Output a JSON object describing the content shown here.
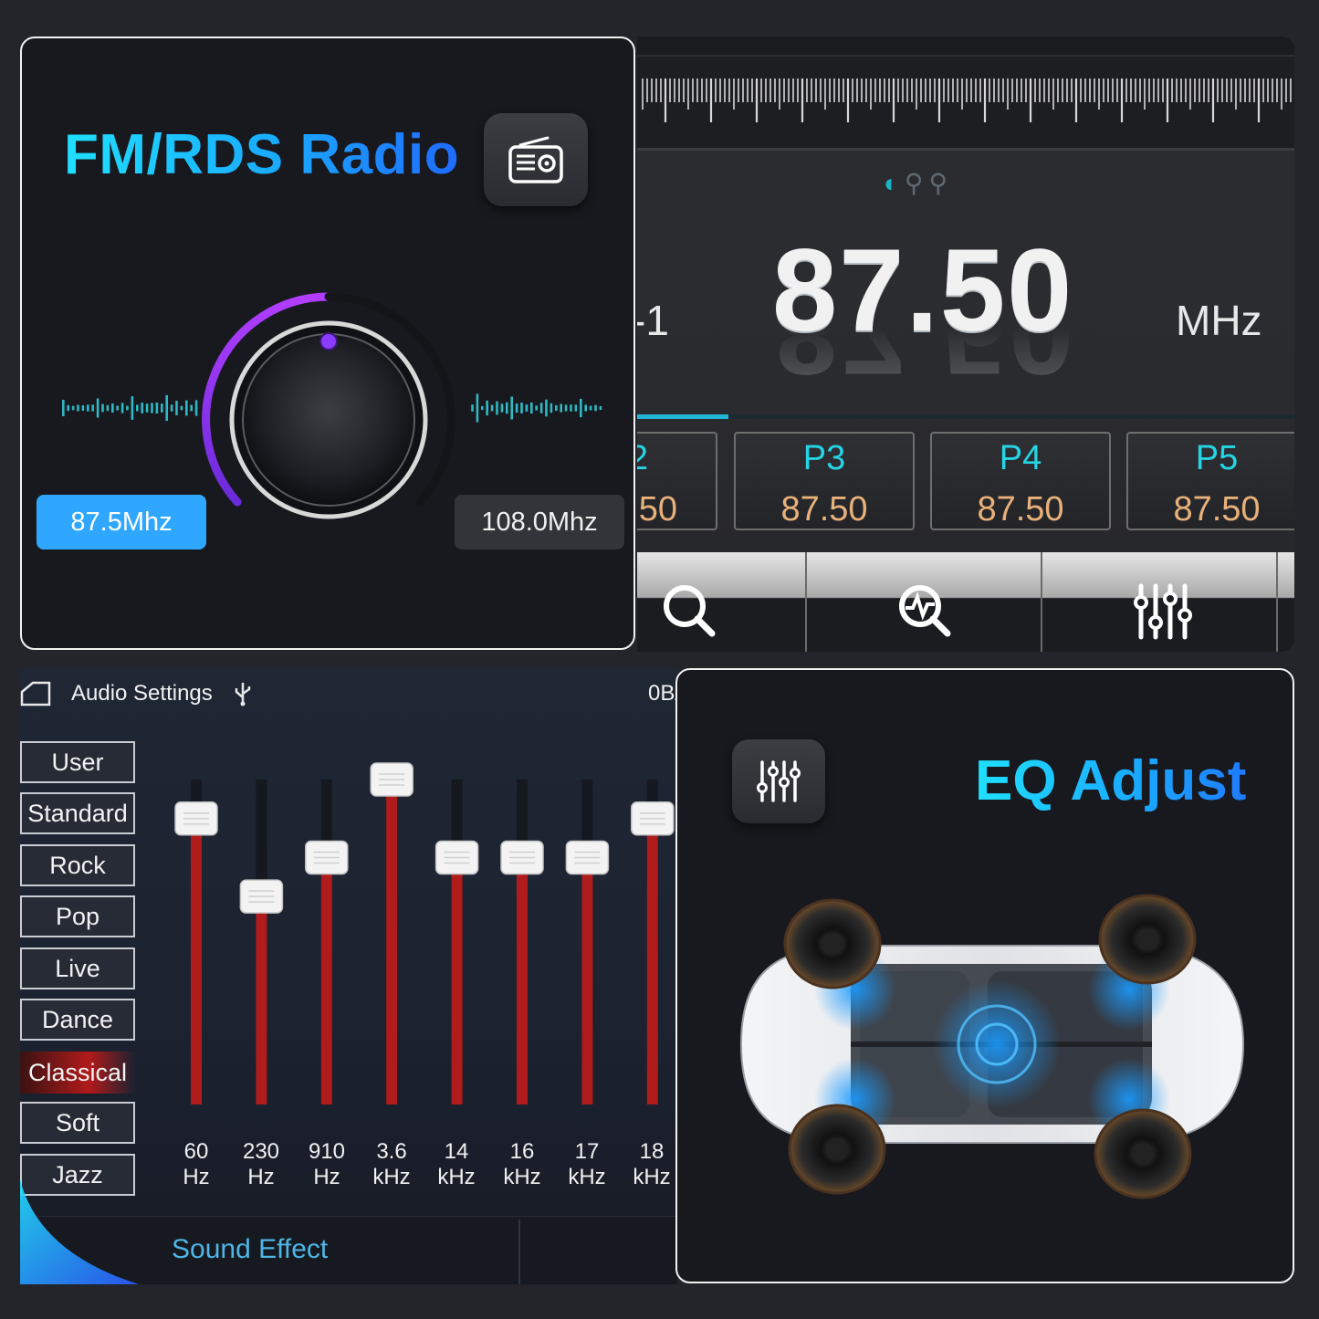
{
  "radio_promo": {
    "title": "FM/RDS Radio",
    "icon": "radio-icon",
    "freq_min": "87.5Mhz",
    "freq_max": "108.0Mhz",
    "knob_icon": "volume-knob"
  },
  "radio_screen": {
    "status_icons": [
      "power-icon",
      "search-icon",
      "scan-icon"
    ],
    "band_fragment": "-1",
    "frequency": "87.50",
    "unit": "MHz",
    "presets": [
      {
        "name": "2",
        "freq": "50"
      },
      {
        "name": "P3",
        "freq": "87.50"
      },
      {
        "name": "P4",
        "freq": "87.50"
      },
      {
        "name": "P5",
        "freq": "87.50"
      }
    ],
    "toolbar_icons": [
      "search-icon",
      "scan-search-icon",
      "equalizer-icon"
    ],
    "accent_color": "#20b4d6",
    "preset_name_color": "#25d5e6",
    "preset_freq_color": "#e9b17a"
  },
  "audio_settings": {
    "title": "Audio Settings",
    "usb_icon": "usb-icon",
    "home_icon": "home-icon",
    "right_fragment": "0B/",
    "presets": [
      "User",
      "Standard",
      "Rock",
      "Pop",
      "Live",
      "Dance",
      "Classical",
      "Soft",
      "Jazz"
    ],
    "active_preset": "Classical",
    "eq_bands": [
      {
        "freq": "60",
        "unit": "Hz",
        "level": 0.88
      },
      {
        "freq": "230",
        "unit": "Hz",
        "level": 0.64
      },
      {
        "freq": "910",
        "unit": "Hz",
        "level": 0.76
      },
      {
        "freq": "3.6",
        "unit": "kHz",
        "level": 1.0
      },
      {
        "freq": "14",
        "unit": "kHz",
        "level": 0.76
      },
      {
        "freq": "16",
        "unit": "kHz",
        "level": 0.76
      },
      {
        "freq": "17",
        "unit": "kHz",
        "level": 0.76
      },
      {
        "freq": "18",
        "unit": "kHz",
        "level": 0.88
      }
    ],
    "bottom_tab": "Sound Effect",
    "slider_color": "#b01b1b"
  },
  "eq_promo": {
    "title": "EQ Adjust",
    "icon": "equalizer-icon",
    "image": "car-speakers-topview"
  }
}
